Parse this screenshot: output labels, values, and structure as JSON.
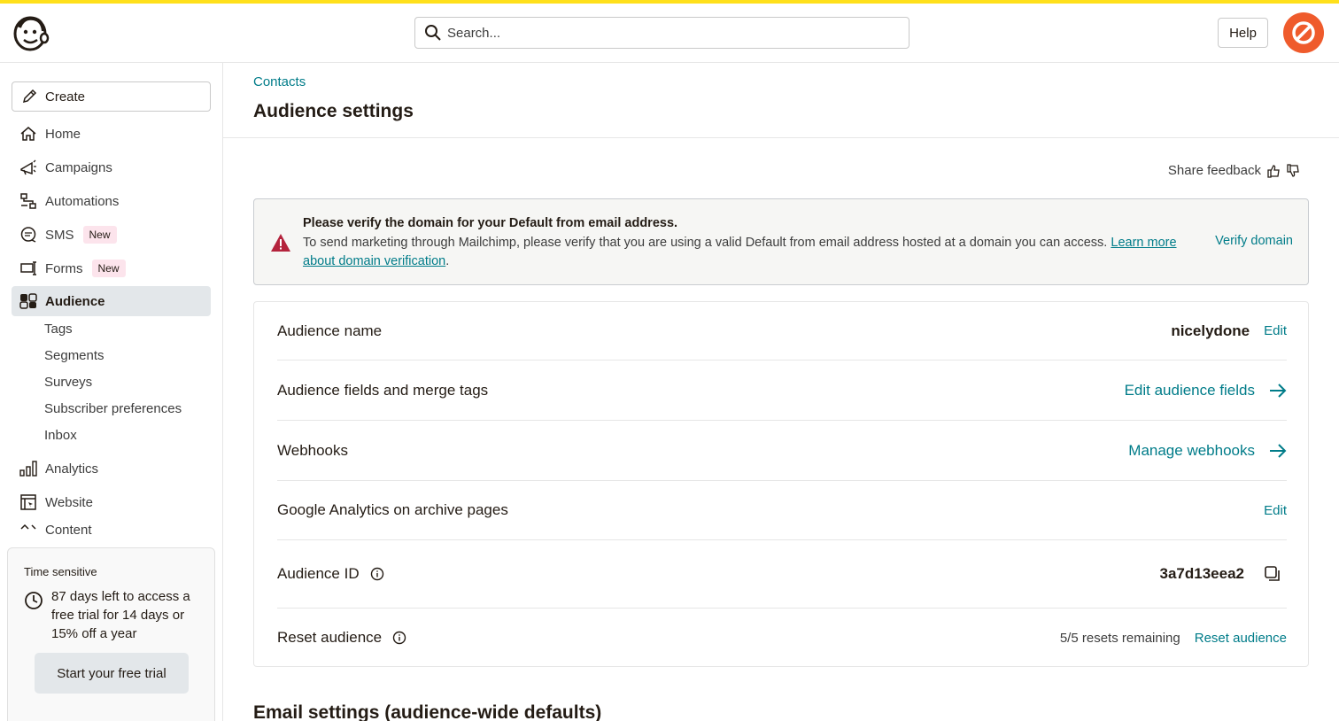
{
  "colors": {
    "accent": "#007c89",
    "brand_yellow": "#ffe01b",
    "avatar_bg": "#ef5b2c",
    "alert_red": "#b4233c"
  },
  "topbar": {
    "search_placeholder": "Search...",
    "help_label": "Help"
  },
  "sidebar": {
    "create_label": "Create",
    "items": [
      {
        "label": "Home",
        "icon": "home-icon"
      },
      {
        "label": "Campaigns",
        "icon": "megaphone-icon"
      },
      {
        "label": "Automations",
        "icon": "automations-icon"
      },
      {
        "label": "SMS",
        "icon": "chat-icon",
        "badge": "New"
      },
      {
        "label": "Forms",
        "icon": "forms-icon",
        "badge": "New"
      },
      {
        "label": "Audience",
        "icon": "audience-icon"
      }
    ],
    "sub_items": [
      "Tags",
      "Segments",
      "Surveys",
      "Subscriber preferences",
      "Inbox"
    ],
    "lower_items": [
      {
        "label": "Analytics",
        "icon": "bar-chart-icon"
      },
      {
        "label": "Website",
        "icon": "website-icon"
      },
      {
        "label": "Content",
        "icon": "content-icon"
      }
    ],
    "trial": {
      "label": "Time sensitive",
      "text": "87 days left to access a free trial for 14 days or 15% off a year",
      "button": "Start your free trial"
    }
  },
  "main": {
    "breadcrumb": "Contacts",
    "title": "Audience settings",
    "feedback_label": "Share feedback",
    "alert": {
      "title": "Please verify the domain for your Default from email address.",
      "body": "To send marketing through Mailchimp, please verify that you are using a valid Default from email address hosted at a domain you can access. ",
      "learn_link": "Learn more about domain verification",
      "body_end": ".",
      "action": "Verify domain"
    },
    "rows": {
      "name": {
        "label": "Audience name",
        "value": "nicelydone",
        "action": "Edit"
      },
      "fields": {
        "label": "Audience fields and merge tags",
        "action": "Edit audience fields"
      },
      "webhooks": {
        "label": "Webhooks",
        "action": "Manage webhooks"
      },
      "ga": {
        "label": "Google Analytics on archive pages",
        "action": "Edit"
      },
      "id": {
        "label": "Audience ID",
        "value": "3a7d13eea2"
      },
      "reset": {
        "label": "Reset audience",
        "remaining": "5/5 resets remaining",
        "action": "Reset audience"
      }
    },
    "email_settings_heading": "Email settings (audience-wide defaults)"
  }
}
